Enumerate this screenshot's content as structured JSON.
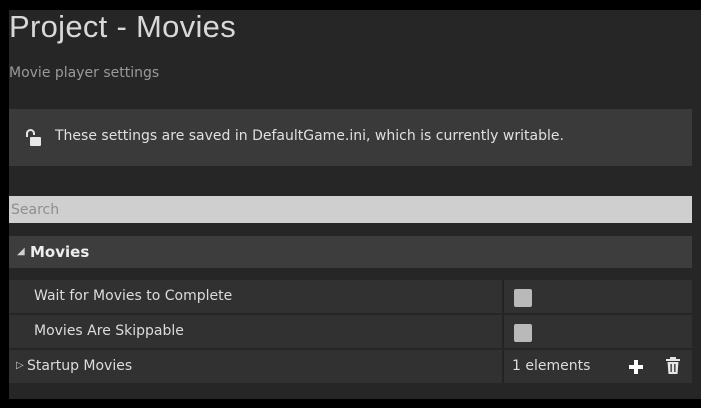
{
  "header": {
    "title": "Project - Movies",
    "subtitle": "Movie player settings"
  },
  "notice": {
    "icon": "unlocked-lock-icon",
    "text": "These settings are saved in DefaultGame.ini, which is currently writable."
  },
  "search": {
    "placeholder": "Search",
    "value": ""
  },
  "category": {
    "arrow": "◢",
    "label": "Movies"
  },
  "properties": [
    {
      "label": "Wait for Movies to Complete",
      "checked": false
    },
    {
      "label": "Movies Are Skippable",
      "checked": false
    }
  ],
  "startup_movies": {
    "expander": "▷",
    "label": "Startup Movies",
    "count": "1 elements",
    "add_icon": "plus-icon",
    "delete_icon": "trash-icon"
  },
  "colors": {
    "background": "#262626",
    "notice": "#3a3a3a",
    "category": "#3d3d3d",
    "row": "#313131",
    "checkbox": "#b9b9b9"
  }
}
